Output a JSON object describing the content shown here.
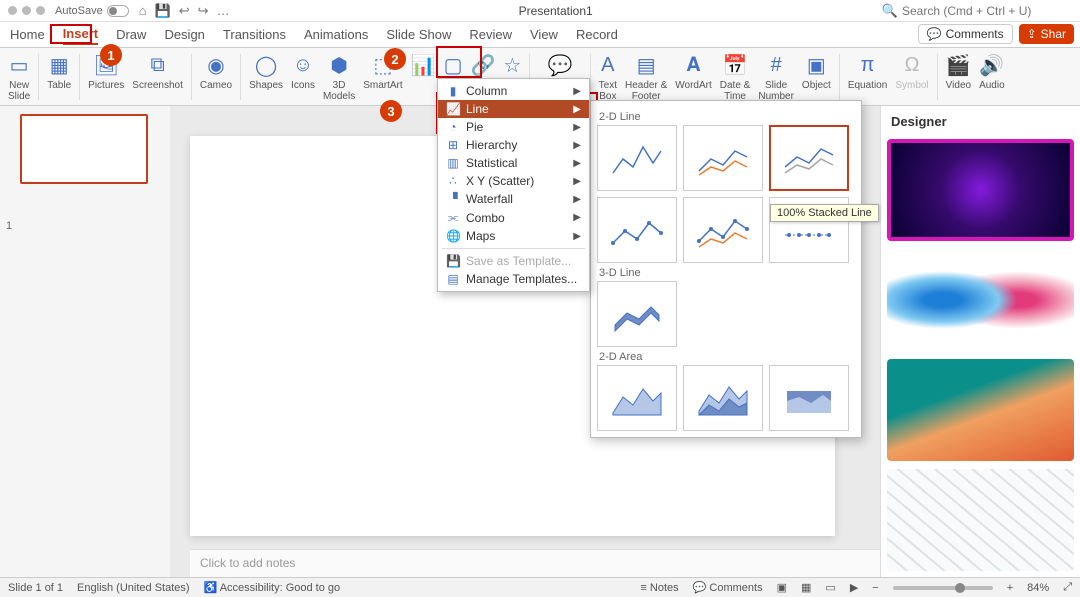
{
  "title": "Presentation1",
  "autosave_label": "AutoSave",
  "search_placeholder": "Search (Cmd + Ctrl + U)",
  "tabs": [
    "Home",
    "Insert",
    "Draw",
    "Design",
    "Transitions",
    "Animations",
    "Slide Show",
    "Review",
    "View",
    "Record"
  ],
  "active_tab": "Insert",
  "comments_label": "Comments",
  "share_label": "Shar",
  "ribbon": {
    "new_slide": "New\nSlide",
    "table": "Table",
    "pictures": "Pictures",
    "screenshot": "Screenshot",
    "cameo": "Cameo",
    "shapes": "Shapes",
    "icons": "Icons",
    "models": "3D\nModels",
    "smartart": "SmartArt",
    "chart": "Chart",
    "comment": "Comment",
    "textbox": "Text\nBox",
    "headerfooter": "Header &\nFooter",
    "wordart": "WordArt",
    "datetime": "Date &\nTime",
    "slidenum": "Slide\nNumber",
    "object": "Object",
    "equation": "Equation",
    "symbol": "Symbol",
    "video": "Video",
    "audio": "Audio"
  },
  "badges": {
    "b1": "1",
    "b2": "2",
    "b3": "3"
  },
  "chart_menu": {
    "items": [
      "Column",
      "Line",
      "Pie",
      "Hierarchy",
      "Statistical",
      "X Y (Scatter)",
      "Waterfall",
      "Combo",
      "Maps"
    ],
    "save_as": "Save as Template...",
    "manage": "Manage Templates..."
  },
  "flyout": {
    "section_2d_line": "2-D Line",
    "section_3d_line": "3-D Line",
    "section_2d_area": "2-D Area",
    "tooltip": "100% Stacked Line"
  },
  "thumb_number": "1",
  "notes_placeholder": "Click to add notes",
  "designer_title": "Designer",
  "status": {
    "slide": "Slide 1 of 1",
    "lang": "English (United States)",
    "access": "Accessibility: Good to go",
    "notes": "Notes",
    "comments": "Comments",
    "zoom": "84%"
  }
}
